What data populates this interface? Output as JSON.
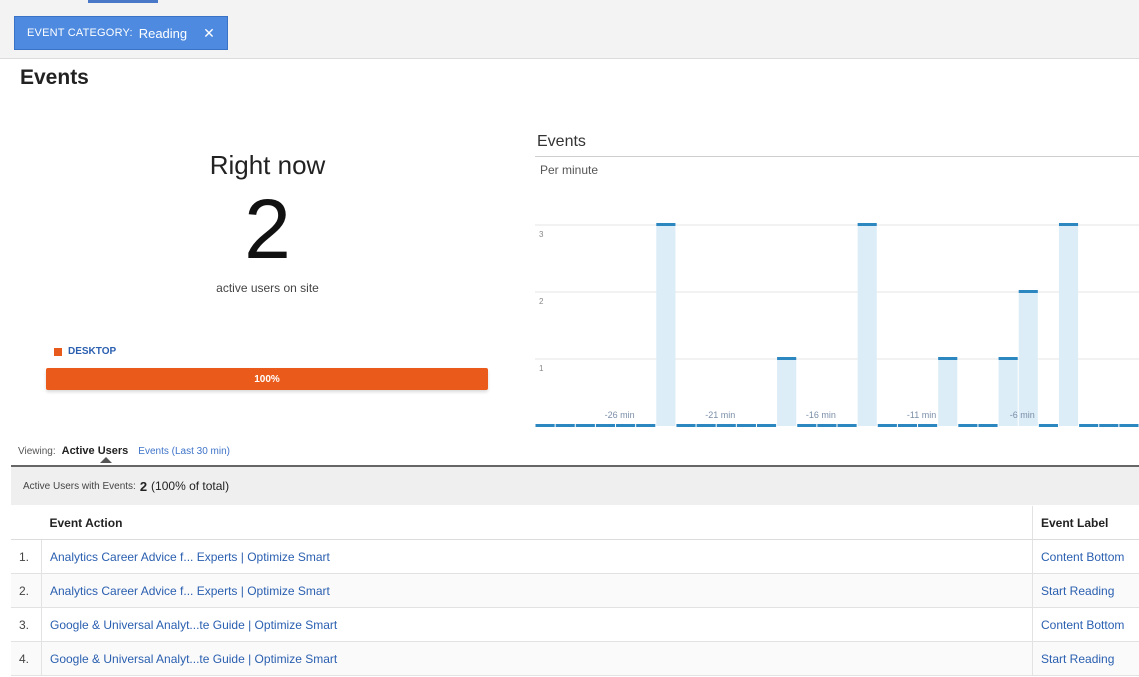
{
  "filter": {
    "key": "EVENT CATEGORY:",
    "value": "Reading",
    "remove_icon": "close-icon"
  },
  "page": {
    "title": "Events"
  },
  "right_now": {
    "label": "Right now",
    "count": "2",
    "sub": "active users on site"
  },
  "device": {
    "name": "DESKTOP",
    "percent_label": "100%",
    "percent": 100,
    "color": "#ea5a1a"
  },
  "chart_panel": {
    "title": "Events",
    "subtitle": "Per minute"
  },
  "chart_data": {
    "type": "bar",
    "ylim": [
      0,
      3
    ],
    "y_ticks": [
      "1",
      "2",
      "3"
    ],
    "x_tick_labels": [
      "-26 min",
      "-21 min",
      "-16 min",
      "-11 min",
      "-6 min"
    ],
    "categories": [
      "-30",
      "-29",
      "-28",
      "-27",
      "-26",
      "-25",
      "-24",
      "-23",
      "-22",
      "-21",
      "-20",
      "-19",
      "-18",
      "-17",
      "-16",
      "-15",
      "-14",
      "-13",
      "-12",
      "-11",
      "-10",
      "-9",
      "-8",
      "-7",
      "-6",
      "-5",
      "-4",
      "-3",
      "-2",
      "-1"
    ],
    "values": [
      0,
      0,
      0,
      0,
      0,
      0,
      3,
      0,
      0,
      0,
      0,
      0,
      1,
      0,
      0,
      0,
      3,
      0,
      0,
      0,
      1,
      0,
      0,
      1,
      2,
      0,
      3,
      0,
      0,
      0
    ],
    "bar_color": "#dcedf7",
    "cap_color": "#2c86c0",
    "grid": true
  },
  "viewing": {
    "prefix": "Viewing:",
    "active_tab": "Active Users",
    "other_tab": "Events (Last 30 min)"
  },
  "summary": {
    "label": "Active Users with Events:",
    "count": "2",
    "pct": "(100% of total)"
  },
  "table": {
    "headers": {
      "action": "Event Action",
      "label": "Event Label"
    },
    "rows": [
      {
        "index": "1.",
        "action": "Analytics Career Advice f... Experts | Optimize Smart",
        "label": "Content Bottom"
      },
      {
        "index": "2.",
        "action": "Analytics Career Advice f... Experts | Optimize Smart",
        "label": "Start Reading"
      },
      {
        "index": "3.",
        "action": "Google & Universal Analyt...te Guide | Optimize Smart",
        "label": "Content Bottom"
      },
      {
        "index": "4.",
        "action": "Google & Universal Analyt...te Guide | Optimize Smart",
        "label": "Start Reading"
      }
    ]
  }
}
